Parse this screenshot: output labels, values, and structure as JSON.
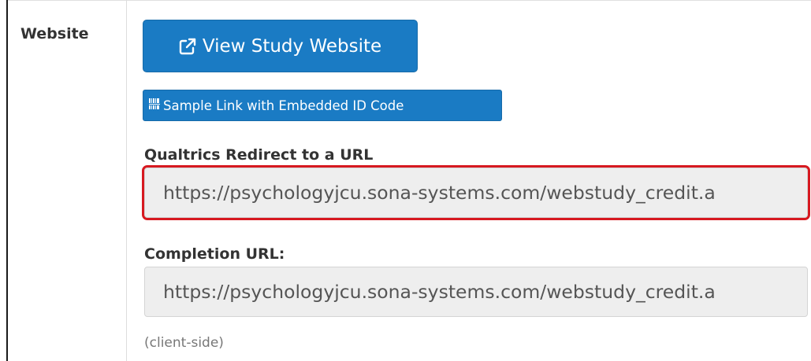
{
  "row": {
    "label": "Website"
  },
  "buttons": {
    "view_study_website": "View Study Website",
    "sample_link": "Sample Link with Embedded ID Code"
  },
  "qualtrics": {
    "label": "Qualtrics Redirect to a URL",
    "value": "https://psychologyjcu.sona-systems.com/webstudy_credit.a"
  },
  "completion": {
    "label": "Completion URL:",
    "value": "https://psychologyjcu.sona-systems.com/webstudy_credit.a",
    "hint": "(client-side)"
  },
  "icons": {
    "view_study": "external-link-icon",
    "sample_link": "barcode-icon"
  },
  "colors": {
    "primary": "#1a7bc4",
    "highlight": "#d71920",
    "input_bg": "#eeeeee"
  }
}
